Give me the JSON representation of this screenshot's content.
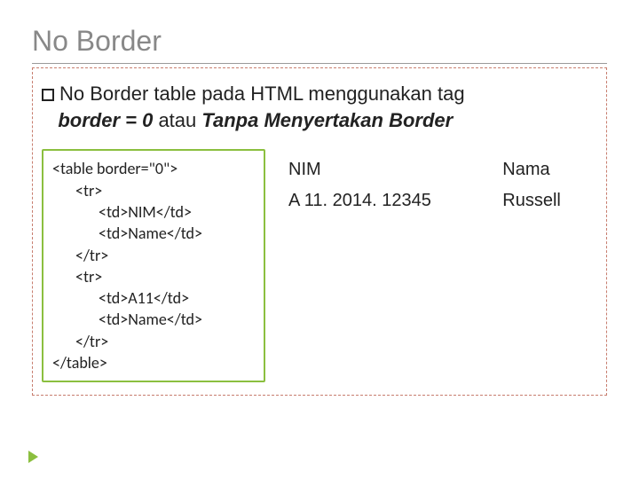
{
  "title": "No Border",
  "bullet": {
    "part1": "No Border table pada HTML  menggunakan tag ",
    "strong1": "border = 0",
    "mid": " atau ",
    "strong2": "Tanpa Menyertakan Border"
  },
  "code": {
    "l1": "<table border=\"0\">",
    "l2": "<tr>",
    "l3": "<td>NIM</td>",
    "l4": "<td>Name</td>",
    "l5": "</tr>",
    "l6": "<tr>",
    "l7": "<td>A11</td>",
    "l8": "<td>Name</td>",
    "l9": "</tr>",
    "l10": "</table>"
  },
  "output": {
    "r1c1": "NIM",
    "r1c2": "Nama",
    "r2c1": "A 11. 2014. 12345",
    "r2c2": "Russell"
  }
}
